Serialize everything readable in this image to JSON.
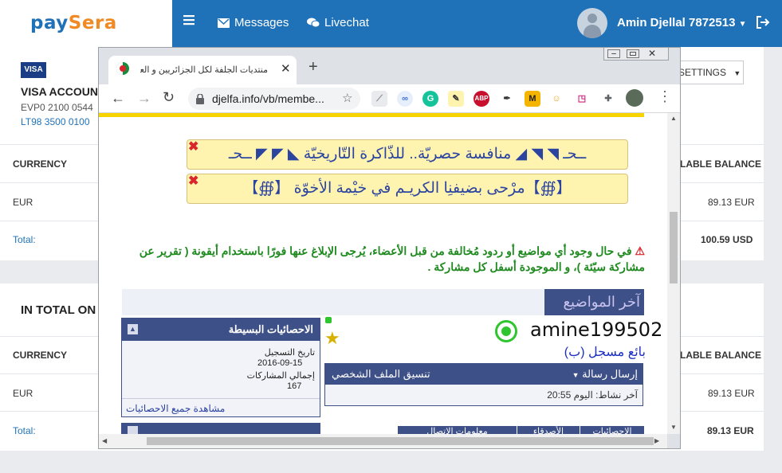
{
  "brand": {
    "logo_left": "pay",
    "logo_right": "Sera"
  },
  "nav": {
    "messages": "Messages",
    "livechat": "Livechat",
    "user": "Amin Djellal 7872513"
  },
  "account": {
    "card_label": "VISA",
    "title": "VISA ACCOUN",
    "evp": "EVP0 2100 0544",
    "iban": "LT98 3500 0100",
    "settings": "SETTINGS"
  },
  "table1": {
    "col_currency": "CURRENCY",
    "col_balance": "LABLE BALANCE",
    "currency": "EUR",
    "amount": "89.13 EUR",
    "total_label": "Total:",
    "total_value": "100.59 USD"
  },
  "total_section": {
    "title": "IN TOTAL ON"
  },
  "table2": {
    "col_currency": "CURRENCY",
    "col_balance": "LABLE BALANCE",
    "currency": "EUR",
    "amount": "89.13 EUR",
    "total_label": "Total:",
    "total_value": "89.13 EUR"
  },
  "browser": {
    "tab_title": "منتديات الجلفة لكل الجزائريين و العرب - م",
    "url": "djelfa.info/vb/membe...",
    "extensions": [
      "M",
      "ABP"
    ]
  },
  "forum": {
    "notice1": "ــحـ ◥ ◥ ◢ منافسة حصريّة.. للذّاكرة التّاريخيّة ◣ ◤ ◤ ــحـ",
    "notice2": "【∰】مرْحى بضيفنِا الكريـم في خيْمة الأخوّة 【∰】",
    "report_text": "في حال وجود أي مواضيع أو ردود مُخالفة من قبل الأعضاء، يُرجى الإبلاغ عنها فورًا باستخدام أيقونة  ( تقرير عن مشاركة سيّئة )، و الموجودة أسفل كل مشاركة .",
    "latest_topics": "آخر المواضيع",
    "username": "amine199502",
    "rank": "بائع مسجل (ب)",
    "send_message": "إرسال رسالة",
    "profile_format": "تنسيق الملف الشخصي",
    "last_activity": "آخر نشاط: اليوم 20:55",
    "stats_title": "الاحصائيات البسيطة",
    "reg_date_label": "تاريخ التسجيل",
    "reg_date": "2016-09-15",
    "posts_label": "إجمالي المشاركات",
    "posts": "167",
    "view_all_stats": "مشاهدة جميع الاحصائيات",
    "bottom_tabs": [
      "الاحصائيات",
      "الأصدقاء",
      "معلومات الاتصال"
    ]
  },
  "colors": {
    "brand_blue": "#1f72b8",
    "brand_orange": "#f08a24",
    "forum_header": "#3e5088",
    "notice_bg": "#fff3b0"
  }
}
